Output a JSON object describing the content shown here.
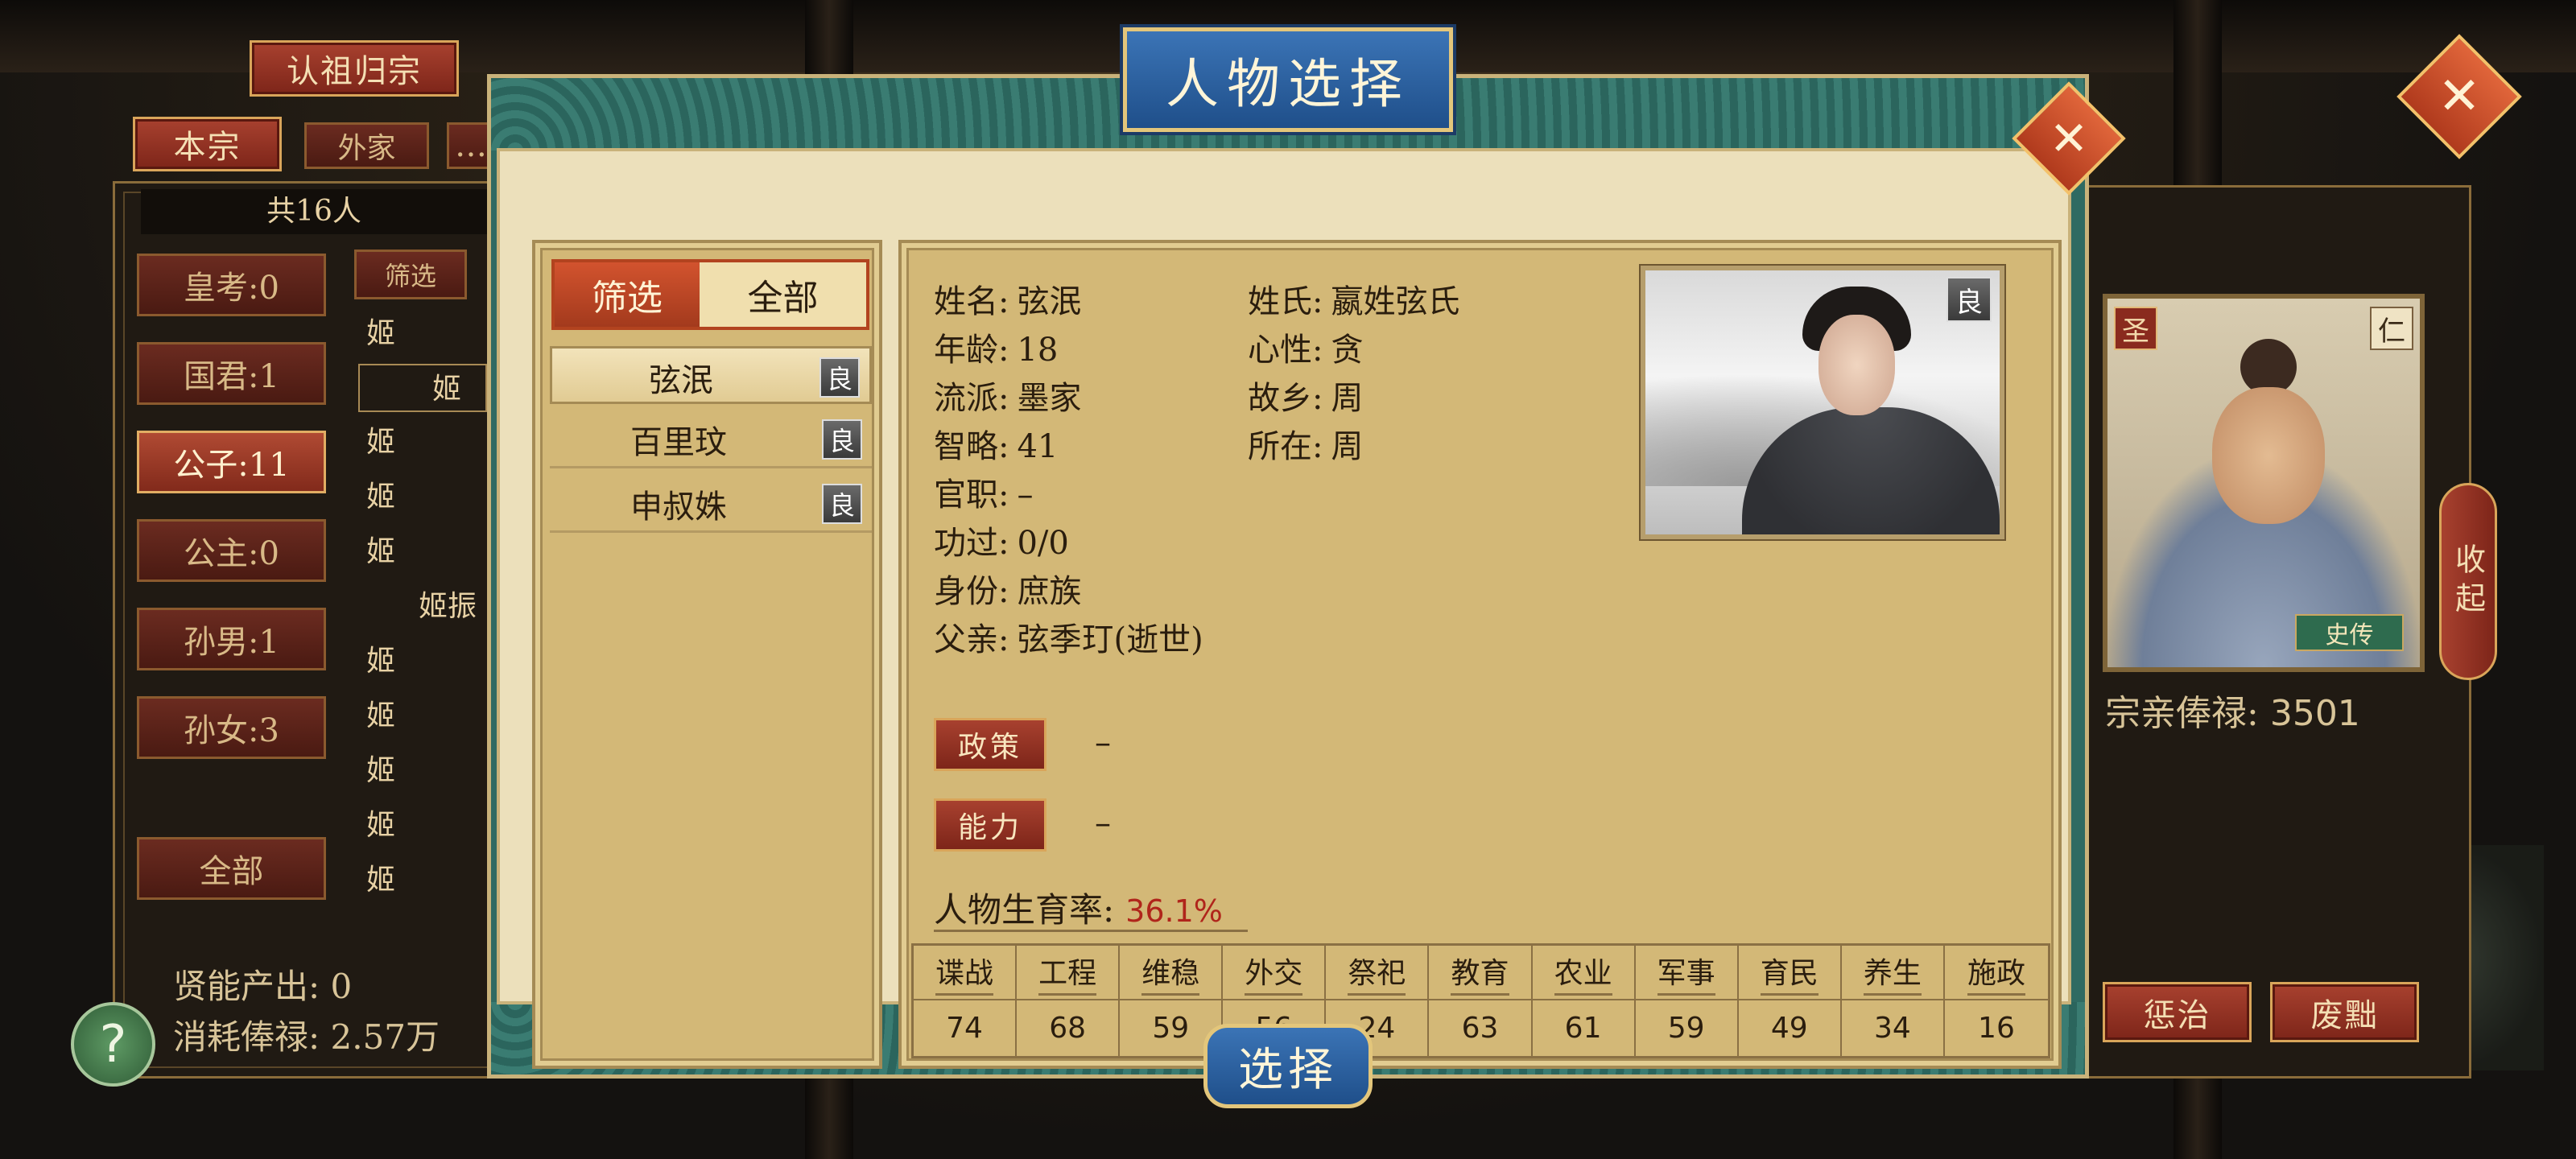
{
  "clan_panel": {
    "header": "认祖归宗",
    "tabs": [
      "本宗",
      "外家",
      "…"
    ],
    "count": "共16人",
    "categories": [
      {
        "label": "皇考:0"
      },
      {
        "label": "国君:1"
      },
      {
        "label": "公子:11"
      },
      {
        "label": "公主:0"
      },
      {
        "label": "孙男:1"
      },
      {
        "label": "孙女:3"
      }
    ],
    "all_button": "全部",
    "filter_label": "筛选",
    "names": [
      "姬",
      "姬",
      "姬",
      "姬",
      "姬",
      "姬振",
      "姬",
      "姬",
      "姬",
      "姬",
      "姬"
    ],
    "output_label": "贤能产出:",
    "output_value": "0",
    "salary_label": "消耗俸禄:",
    "salary_value": "2.57万",
    "help": "?"
  },
  "right_panel": {
    "tag_sheng": "圣",
    "tag_ren": "仁",
    "tag_shizhuan": "史传",
    "collapse": "收起",
    "stipend_label": "宗亲俸禄:",
    "stipend_value": "3501",
    "punish": "惩治",
    "depose": "废黜",
    "close": "✕"
  },
  "modal": {
    "title": "人物选择",
    "close": "✕",
    "select_button": "选择",
    "filter_tab": "筛选",
    "all_tab": "全部",
    "candidates": [
      {
        "name": "弦泯",
        "grade": "良",
        "selected": true
      },
      {
        "name": "百里玟",
        "grade": "良",
        "selected": false
      },
      {
        "name": "申叔姝",
        "grade": "良",
        "selected": false
      }
    ],
    "info": {
      "name_label": "姓名:",
      "name": "弦泯",
      "surname_label": "姓氏:",
      "surname": "嬴姓弦氏",
      "age_label": "年龄:",
      "age": "18",
      "temper_label": "心性:",
      "temper": "贪",
      "school_label": "流派:",
      "school": "墨家",
      "hometown_label": "故乡:",
      "hometown": "周",
      "wisdom_label": "智略:",
      "wisdom": "41",
      "location_label": "所在:",
      "location": "周",
      "office_label": "官职:",
      "office": "–",
      "merit_label": "功过:",
      "merit": "0/0",
      "status_label": "身份:",
      "status": "庶族",
      "father_label": "父亲:",
      "father": "弦季玎(逝世)",
      "portrait_grade": "良",
      "policy_label": "政策",
      "policy_value": "–",
      "ability_label": "能力",
      "ability_value": "–",
      "fertility_label": "人物生育率:",
      "fertility_value": "36.1%"
    },
    "stats": [
      {
        "label": "谍战",
        "value": "74"
      },
      {
        "label": "工程",
        "value": "68"
      },
      {
        "label": "维稳",
        "value": "59"
      },
      {
        "label": "外交",
        "value": "56"
      },
      {
        "label": "祭祀",
        "value": "24"
      },
      {
        "label": "教育",
        "value": "63"
      },
      {
        "label": "农业",
        "value": "61"
      },
      {
        "label": "军事",
        "value": "59"
      },
      {
        "label": "育民",
        "value": "49"
      },
      {
        "label": "养生",
        "value": "34"
      },
      {
        "label": "施政",
        "value": "16"
      }
    ]
  }
}
